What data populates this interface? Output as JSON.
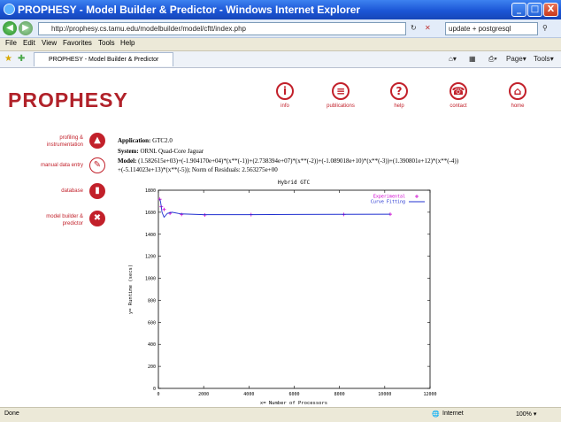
{
  "window": {
    "title": "PROPHESY - Model Builder & Predictor - Windows Internet Explorer",
    "min_label": "_",
    "max_label": "□",
    "close_label": "X"
  },
  "address": {
    "url": "http://prophesy.cs.tamu.edu/modelbuilder/model/cftt/index.php",
    "search_text": "update + postgresql"
  },
  "menu": {
    "items": [
      "File",
      "Edit",
      "View",
      "Favorites",
      "Tools",
      "Help"
    ]
  },
  "tabs": {
    "active_label": "PROPHESY - Model Builder & Predictor",
    "page_label": "Page",
    "tools_label": "Tools"
  },
  "header": {
    "logo": "PROPHESY",
    "nav": [
      {
        "label": "info",
        "icon": "info-icon",
        "glyph": "i"
      },
      {
        "label": "publications",
        "icon": "document-icon",
        "glyph": "≡"
      },
      {
        "label": "help",
        "icon": "help-icon",
        "glyph": "?"
      },
      {
        "label": "contact",
        "icon": "phone-icon",
        "glyph": "☎"
      },
      {
        "label": "home",
        "icon": "car-icon",
        "glyph": "⌂"
      }
    ]
  },
  "sidebar": {
    "items": [
      {
        "label_line1": "profiling &",
        "label_line2": "instrumentation",
        "icon": "profiling-icon",
        "glyph": "▲",
        "style": "filled"
      },
      {
        "label_line1": "manual data entry",
        "label_line2": "",
        "icon": "pencil-icon",
        "glyph": "✎",
        "style": "outline"
      },
      {
        "label_line1": "database",
        "label_line2": "",
        "icon": "database-icon",
        "glyph": "▮",
        "style": "filled"
      },
      {
        "label_line1": "model builder &",
        "label_line2": "predictor",
        "icon": "tools-icon",
        "glyph": "✖",
        "style": "filled"
      }
    ]
  },
  "info": {
    "application_label": "Application:",
    "application_value": "GTC2.0",
    "system_label": "System:",
    "system_value": "ORNL Quad-Core Jaguar",
    "model_label": "Model:",
    "model_line1": "(1.582615e+03)+(-1.904170e+04)*(x**(-1))+(2.738394e+07)*(x**(-2))+(-1.089018e+10)*(x**(-3))+(1.390801e+12)*(x**(-4))",
    "model_line2": "+(-5.114023e+13)*(x**(-5)); Norm of Residuals: 2.563275e+00"
  },
  "chart_data": {
    "type": "line",
    "title": "Hybrid GTC",
    "xlabel": "x= Number of Processors",
    "ylabel": "y= Runtime (secs)",
    "xlim": [
      0,
      12000
    ],
    "ylim": [
      0,
      1800
    ],
    "xticks": [
      "0",
      "2000",
      "4000",
      "6000",
      "8000",
      "10000",
      "12000"
    ],
    "yticks": [
      "0",
      "200",
      "400",
      "600",
      "800",
      "1000",
      "1200",
      "1400",
      "1600",
      "1800"
    ],
    "legend": "top-right",
    "grid": false,
    "series": [
      {
        "name": "Experimental",
        "style": "points",
        "marker": "+",
        "color": "#d000d0",
        "x": [
          64,
          128,
          256,
          512,
          1024,
          2048,
          4096,
          8192,
          10240
        ],
        "y": [
          1718,
          1650,
          1625,
          1590,
          1580,
          1575,
          1578,
          1580,
          1582
        ]
      },
      {
        "name": "Curve Fitting",
        "style": "line",
        "color": "#2030d0",
        "x": [
          64,
          100,
          160,
          250,
          400,
          600,
          1000,
          2000,
          4000,
          6000,
          8000,
          10240
        ],
        "y": [
          1720,
          1690,
          1600,
          1555,
          1590,
          1600,
          1585,
          1578,
          1578,
          1580,
          1581,
          1582
        ]
      }
    ]
  },
  "status": {
    "left": "Done",
    "zone": "Internet",
    "zoom": "100%"
  }
}
